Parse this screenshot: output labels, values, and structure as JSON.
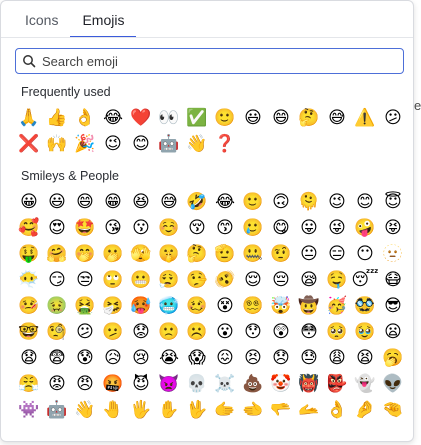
{
  "tabs": [
    {
      "label": "Icons",
      "active": false
    },
    {
      "label": "Emojis",
      "active": true
    }
  ],
  "search": {
    "placeholder": "Search emoji",
    "value": ""
  },
  "background_text": "ea",
  "frequently_used": {
    "title": "Frequently used",
    "emojis": [
      "🙏",
      "👍",
      "👌",
      "😂",
      "❤️",
      "👀",
      "✅",
      "🙂",
      "😃",
      "😄",
      "🤔",
      "😅",
      "⚠️",
      "😕",
      "❌",
      "🙌",
      "🎉",
      "😉",
      "😊",
      "🤖",
      "👋",
      "❓"
    ]
  },
  "smileys_people": {
    "title": "Smileys & People",
    "emojis": [
      "😀",
      "😃",
      "😄",
      "😁",
      "😆",
      "😅",
      "🤣",
      "😂",
      "🙂",
      "🙃",
      "🫠",
      "😉",
      "😊",
      "😇",
      "🥰",
      "😍",
      "🤩",
      "😘",
      "😗",
      "☺️",
      "😚",
      "😙",
      "🥲",
      "😋",
      "😛",
      "😜",
      "🤪",
      "😝",
      "🤑",
      "🤗",
      "🤭",
      "🫢",
      "🫣",
      "🤫",
      "🤔",
      "🫡",
      "🤐",
      "🤨",
      "😐",
      "😑",
      "😶",
      "🫥",
      "😶‍🌫️",
      "😏",
      "😒",
      "🙄",
      "😬",
      "😮‍💨",
      "🤥",
      "🫨",
      "😌",
      "😔",
      "😪",
      "🤤",
      "😴",
      "😷",
      "🤒",
      "🤢",
      "🤮",
      "🤧",
      "🥵",
      "🥶",
      "🥴",
      "😵",
      "😵‍💫",
      "🤯",
      "🤠",
      "🥳",
      "🥸",
      "😎",
      "🤓",
      "🧐",
      "😕",
      "🫤",
      "😟",
      "🙁",
      "☹️",
      "😮",
      "😯",
      "😲",
      "😳",
      "🥺",
      "🥹",
      "😦",
      "😧",
      "😨",
      "😰",
      "😥",
      "😢",
      "😭",
      "😱",
      "😖",
      "😣",
      "😞",
      "😓",
      "😩",
      "😫",
      "🥱",
      "😤",
      "😡",
      "😠",
      "🤬",
      "😈",
      "👿",
      "💀",
      "☠️",
      "💩",
      "🤡",
      "👹",
      "👺",
      "👻",
      "👽",
      "👾",
      "🤖",
      "👋",
      "🤚",
      "🖐️",
      "✋",
      "🖖",
      "🫱",
      "🫲",
      "🫳",
      "🫴",
      "👌",
      "🤌",
      "🤏"
    ]
  }
}
